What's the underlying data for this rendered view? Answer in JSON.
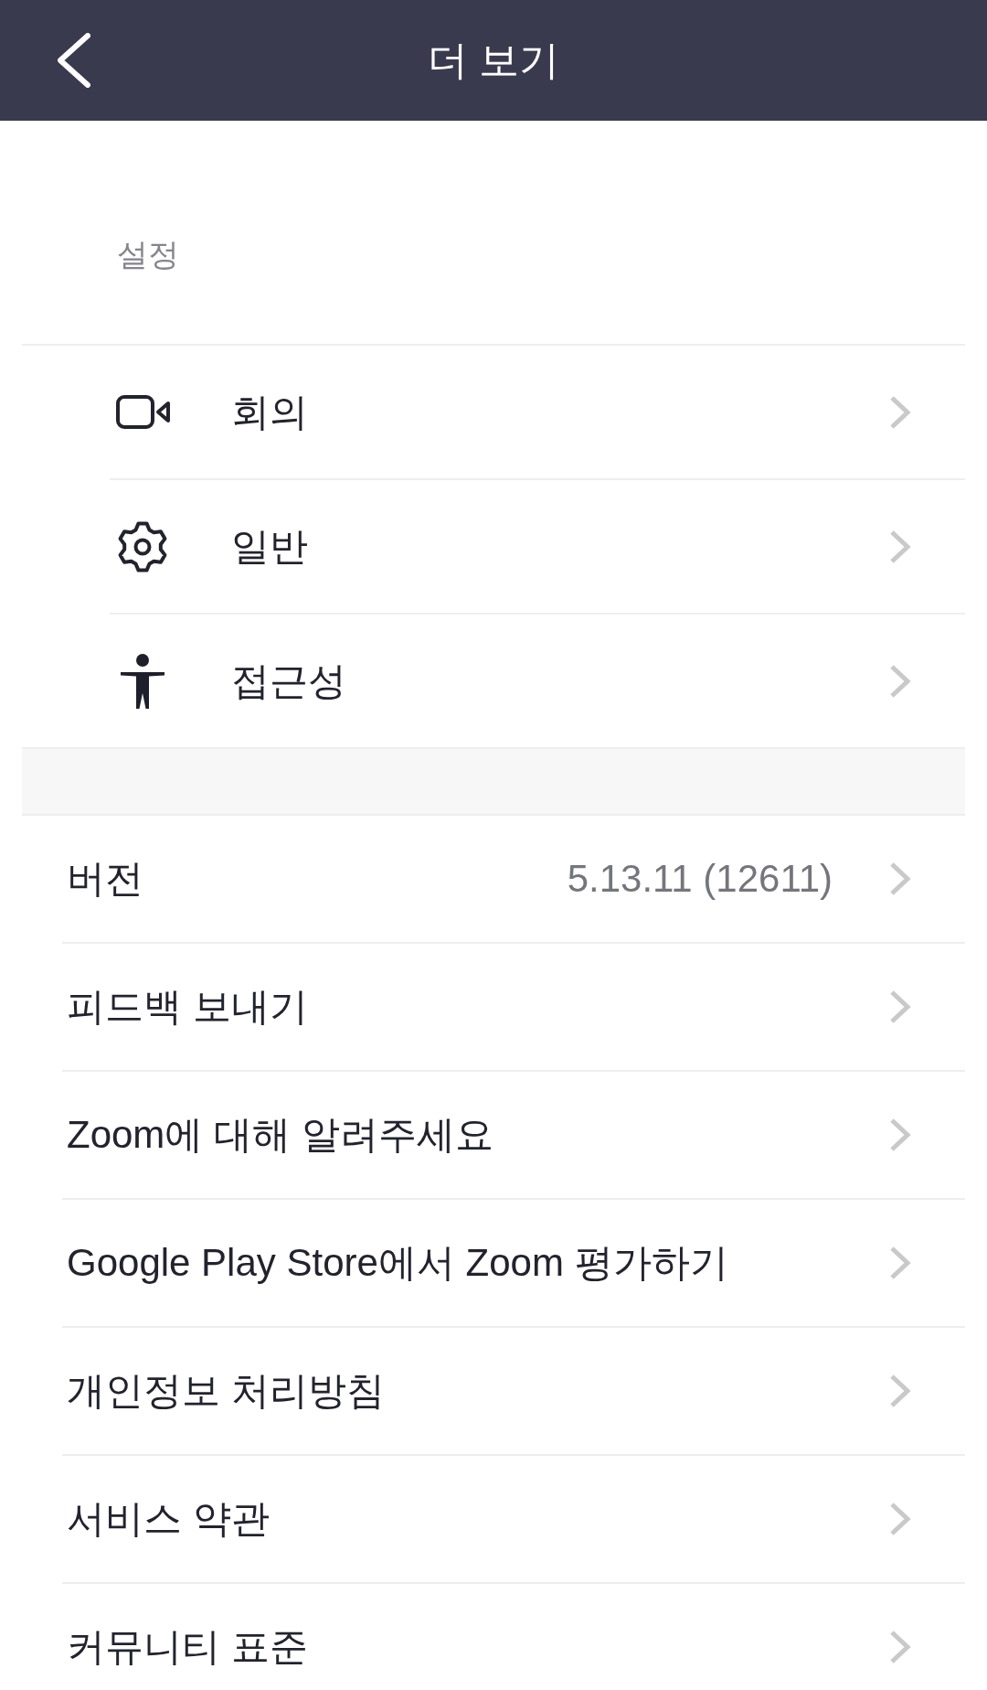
{
  "header": {
    "title": "더 보기"
  },
  "settings": {
    "label": "설정",
    "items": [
      {
        "kind": "camera",
        "label": "회의"
      },
      {
        "kind": "gear",
        "label": "일반"
      },
      {
        "kind": "figure",
        "label": "접근성"
      }
    ]
  },
  "items": [
    {
      "label": "버전",
      "value": "5.13.11 (12611)"
    },
    {
      "label": "피드백 보내기"
    },
    {
      "label": "Zoom에 대해 알려주세요"
    },
    {
      "label": "Google Play Store에서 Zoom 평가하기"
    },
    {
      "label": "개인정보 처리방침"
    },
    {
      "label": "서비스 약관"
    },
    {
      "label": "커뮤니티 표준"
    }
  ]
}
